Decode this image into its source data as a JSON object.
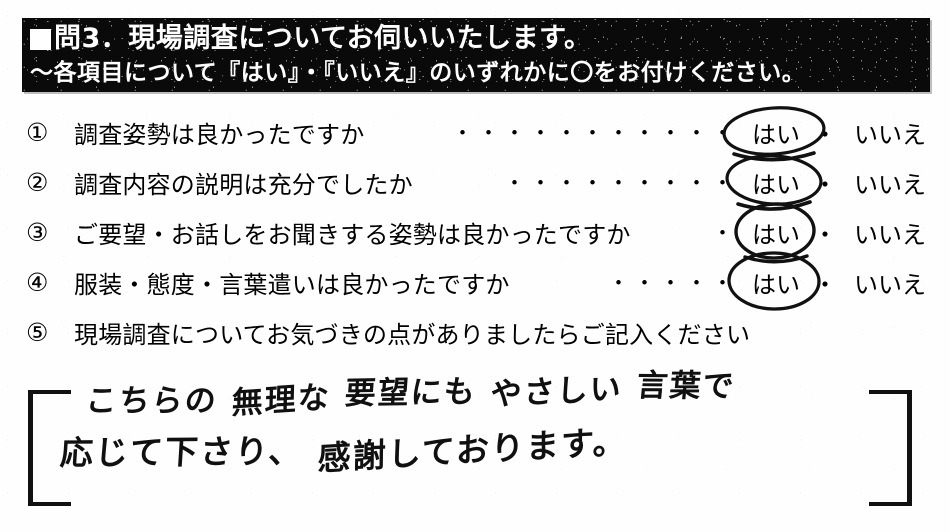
{
  "document": {
    "type": "scanned-questionnaire",
    "language": "ja",
    "ink_color": "#111111",
    "banner_background": "#0a0a0a",
    "banner_text_color": "#ffffff",
    "page_background": "#fefefe"
  },
  "header": {
    "marker_icon": "filled-square-icon",
    "title": "問3．現場調査についてお伺いいたします。",
    "subtitle": "〜各項目について『はい』・『いいえ』のいずれかに〇をお付けください。"
  },
  "questions": [
    {
      "number": "①",
      "text": "調査姿勢は良かったですか",
      "leader": "・・・・・・・・・・・",
      "yes_label": "はい",
      "separator": "・",
      "no_label": "いいえ",
      "selected": "はい",
      "circle_style": "wide-ellipse"
    },
    {
      "number": "②",
      "text": "調査内容の説明は充分でしたか",
      "leader": "・・・・・・・・・",
      "yes_label": "はい",
      "separator": "・",
      "no_label": "いいえ",
      "selected": "はい",
      "circle_style": "wide-ellipse"
    },
    {
      "number": "③",
      "text": "ご要望・お話しをお聞きする姿勢は良かったですか",
      "leader": "・",
      "yes_label": "はい",
      "separator": "・",
      "no_label": "いいえ",
      "selected": "はい",
      "circle_style": "tall-ellipse"
    },
    {
      "number": "④",
      "text": "服装・態度・言葉遣いは良かったですか",
      "leader": "・・・・・",
      "yes_label": "はい",
      "separator": "・",
      "no_label": "いいえ",
      "selected": "はい",
      "circle_style": "round-ellipse"
    },
    {
      "number": "⑤",
      "text": "現場調査についてお気づきの点がありましたらご記入ください",
      "leader": "",
      "yes_label": "",
      "separator": "",
      "no_label": "",
      "selected": "",
      "circle_style": "none"
    }
  ],
  "handwritten_comment": {
    "bracket_left": "[",
    "bracket_right": "]",
    "line_1": "こちらの 無理な 要望にも やさしい 言葉で",
    "line_2": "応じて下さり、感謝しております。",
    "line_1_segments": [
      "こちらの",
      "無理な",
      "要望にも",
      "やさしい",
      "言葉で"
    ],
    "line_2_segments": [
      "応じて下さり、",
      "感謝しております。"
    ]
  }
}
